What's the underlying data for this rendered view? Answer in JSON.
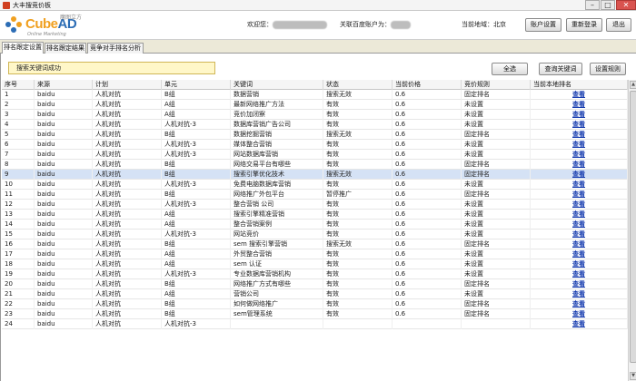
{
  "window": {
    "title": "大丰搜竞价板",
    "minimize": "–",
    "maximize": "□",
    "close": "✕"
  },
  "logo": {
    "brand_a": "Cube",
    "brand_b": "AD",
    "cn": "魔图立方",
    "tagline": "Online Marketing"
  },
  "header": {
    "welcome_label": "欢迎您：",
    "account_label": "关联百度账户为：",
    "location_label": "当前地域：北京",
    "buttons": {
      "account_settings": "账户设置",
      "relogin": "重新登录",
      "logout": "退出"
    }
  },
  "tabs": [
    "排名跟定设置",
    "排名跟定结果",
    "竞争对手排名分析"
  ],
  "status_message": "搜索关键词成功",
  "actions": {
    "select_all": "全选",
    "query_keywords": "查询关键词",
    "set_rules": "设置规则"
  },
  "columns": [
    "序号",
    "来源",
    "计划",
    "单元",
    "关键词",
    "状态",
    "当前价格",
    "竞价规则",
    "当前本地排名"
  ],
  "rows": [
    {
      "id": "1",
      "source": "baidu",
      "plan": "人机对抗",
      "unit": "B组",
      "keyword": "数据营销",
      "status": "搜索无效",
      "price": "0.6",
      "rule": "固定排名",
      "rank": "查看"
    },
    {
      "id": "2",
      "source": "baidu",
      "plan": "人机对抗",
      "unit": "A组",
      "keyword": "最新网络推广方法",
      "status": "有效",
      "price": "0.6",
      "rule": "未设置",
      "rank": "查看"
    },
    {
      "id": "3",
      "source": "baidu",
      "plan": "人机对抗",
      "unit": "A组",
      "keyword": "竞价加闭察",
      "status": "有效",
      "price": "0.6",
      "rule": "未设置",
      "rank": "查看"
    },
    {
      "id": "4",
      "source": "baidu",
      "plan": "人机对抗",
      "unit": "人机对抗-3",
      "keyword": "数据库营销广告公司",
      "status": "有效",
      "price": "0.6",
      "rule": "未设置",
      "rank": "查看"
    },
    {
      "id": "5",
      "source": "baidu",
      "plan": "人机对抗",
      "unit": "B组",
      "keyword": "数据挖掘营销",
      "status": "搜索无效",
      "price": "0.6",
      "rule": "固定排名",
      "rank": "查看"
    },
    {
      "id": "6",
      "source": "baidu",
      "plan": "人机对抗",
      "unit": "人机对抗-3",
      "keyword": "媒体整合营销",
      "status": "有效",
      "price": "0.6",
      "rule": "未设置",
      "rank": "查看"
    },
    {
      "id": "7",
      "source": "baidu",
      "plan": "人机对抗",
      "unit": "人机对抗-3",
      "keyword": "网站数据库营销",
      "status": "有效",
      "price": "0.6",
      "rule": "未设置",
      "rank": "查看"
    },
    {
      "id": "8",
      "source": "baidu",
      "plan": "人机对抗",
      "unit": "B组",
      "keyword": "网络交易平台有哪些",
      "status": "有效",
      "price": "0.6",
      "rule": "固定排名",
      "rank": "查看"
    },
    {
      "id": "9",
      "source": "baidu",
      "plan": "人机对抗",
      "unit": "B组",
      "keyword": "搜索引擎优化技术",
      "status": "搜索无效",
      "price": "0.6",
      "rule": "固定排名",
      "rank": "查看"
    },
    {
      "id": "10",
      "source": "baidu",
      "plan": "人机对抗",
      "unit": "人机对抗-3",
      "keyword": "免费电脑数据库营销",
      "status": "有效",
      "price": "0.6",
      "rule": "未设置",
      "rank": "查看"
    },
    {
      "id": "11",
      "source": "baidu",
      "plan": "人机对抗",
      "unit": "B组",
      "keyword": "网络推广外包平台",
      "status": "暂停推广",
      "price": "0.6",
      "rule": "固定排名",
      "rank": "查看"
    },
    {
      "id": "12",
      "source": "baidu",
      "plan": "人机对抗",
      "unit": "人机对抗-3",
      "keyword": "整合营销 公司",
      "status": "有效",
      "price": "0.6",
      "rule": "未设置",
      "rank": "查看"
    },
    {
      "id": "13",
      "source": "baidu",
      "plan": "人机对抗",
      "unit": "A组",
      "keyword": "搜索引擎精准营销",
      "status": "有效",
      "price": "0.6",
      "rule": "未设置",
      "rank": "查看"
    },
    {
      "id": "14",
      "source": "baidu",
      "plan": "人机对抗",
      "unit": "A组",
      "keyword": "整合营销案例",
      "status": "有效",
      "price": "0.6",
      "rule": "未设置",
      "rank": "查看"
    },
    {
      "id": "15",
      "source": "baidu",
      "plan": "人机对抗",
      "unit": "人机对抗-3",
      "keyword": "网站竞价",
      "status": "有效",
      "price": "0.6",
      "rule": "未设置",
      "rank": "查看"
    },
    {
      "id": "16",
      "source": "baidu",
      "plan": "人机对抗",
      "unit": "B组",
      "keyword": "sem 搜索引擎营销",
      "status": "搜索无效",
      "price": "0.6",
      "rule": "固定排名",
      "rank": "查看"
    },
    {
      "id": "17",
      "source": "baidu",
      "plan": "人机对抗",
      "unit": "A组",
      "keyword": "外贸整合营销",
      "status": "有效",
      "price": "0.6",
      "rule": "未设置",
      "rank": "查看"
    },
    {
      "id": "18",
      "source": "baidu",
      "plan": "人机对抗",
      "unit": "A组",
      "keyword": "sem 认证",
      "status": "有效",
      "price": "0.6",
      "rule": "未设置",
      "rank": "查看"
    },
    {
      "id": "19",
      "source": "baidu",
      "plan": "人机对抗",
      "unit": "人机对抗-3",
      "keyword": "专业数据库营销机构",
      "status": "有效",
      "price": "0.6",
      "rule": "未设置",
      "rank": "查看"
    },
    {
      "id": "20",
      "source": "baidu",
      "plan": "人机对抗",
      "unit": "B组",
      "keyword": "网络推广方式有哪些",
      "status": "有效",
      "price": "0.6",
      "rule": "固定排名",
      "rank": "查看"
    },
    {
      "id": "21",
      "source": "baidu",
      "plan": "人机对抗",
      "unit": "A组",
      "keyword": "营销公司",
      "status": "有效",
      "price": "0.6",
      "rule": "未设置",
      "rank": "查看"
    },
    {
      "id": "22",
      "source": "baidu",
      "plan": "人机对抗",
      "unit": "B组",
      "keyword": "如何做网络推广",
      "status": "有效",
      "price": "0.6",
      "rule": "固定排名",
      "rank": "查看"
    },
    {
      "id": "23",
      "source": "baidu",
      "plan": "人机对抗",
      "unit": "B组",
      "keyword": "sem管理系统",
      "status": "有效",
      "price": "0.6",
      "rule": "固定排名",
      "rank": "查看"
    },
    {
      "id": "24",
      "source": "baidu",
      "plan": "人机对抗",
      "unit": "人机对抗-3",
      "keyword": "",
      "status": "",
      "price": "",
      "rule": "",
      "rank": "查看"
    }
  ],
  "selected_row": 9,
  "colors": {
    "brand_orange": "#f0a020",
    "brand_blue": "#2c6db5",
    "selected_row": "#d5e2f5",
    "link": "#1a3fb0",
    "status_bg": "#fff7c8"
  }
}
